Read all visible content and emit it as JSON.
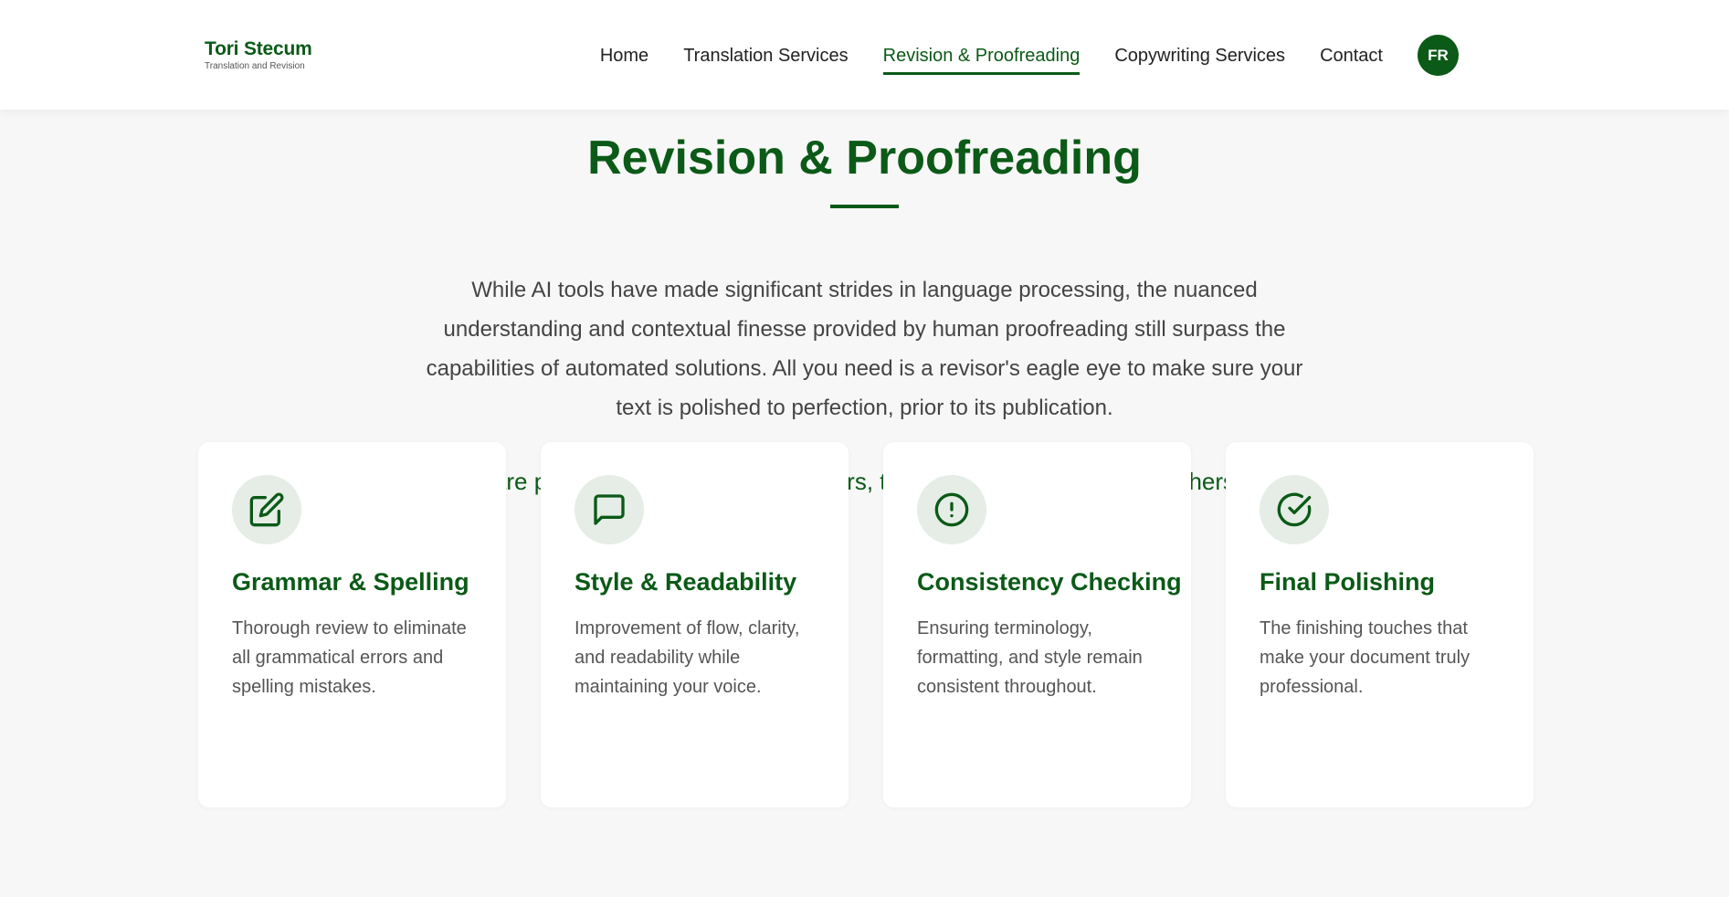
{
  "header": {
    "brand_name": "Tori Stecum",
    "brand_tagline": "Translation and Revision",
    "nav": [
      {
        "label": "Home"
      },
      {
        "label": "Translation Services"
      },
      {
        "label": "Revision & Proofreading"
      },
      {
        "label": "Copywriting Services"
      },
      {
        "label": "Contact"
      }
    ],
    "language_button": "FR"
  },
  "main": {
    "title": "Revision & Proofreading",
    "intro": "While AI tools have made significant strides in language processing, the nuanced understanding and contextual finesse provided by human proofreading still surpass the capabilities of automated solutions. All you need is a revisor's eagle eye to make sure your text is polished to perfection, prior to its publication.",
    "tagline": "We are professional grammatical errors, typos, and inconsistency catchers. 🎣"
  },
  "cards": [
    {
      "icon": "edit-icon",
      "title": "Grammar & Spelling",
      "text": "Thorough review to eliminate all grammatical errors and spelling mistakes."
    },
    {
      "icon": "message-icon",
      "title": "Style & Readability",
      "text": "Improvement of flow, clarity, and readability while maintaining your voice."
    },
    {
      "icon": "alert-circle-icon",
      "title": "Consistency Checking",
      "text": "Ensuring terminology, formatting, and style remain consistent throughout."
    },
    {
      "icon": "check-circle-icon",
      "title": "Final Polishing",
      "text": "The finishing touches that make your document truly professional."
    }
  ],
  "colors": {
    "primary": "#0b5a17",
    "background": "#f7f7f7",
    "icon_bg": "#e5ede6"
  }
}
